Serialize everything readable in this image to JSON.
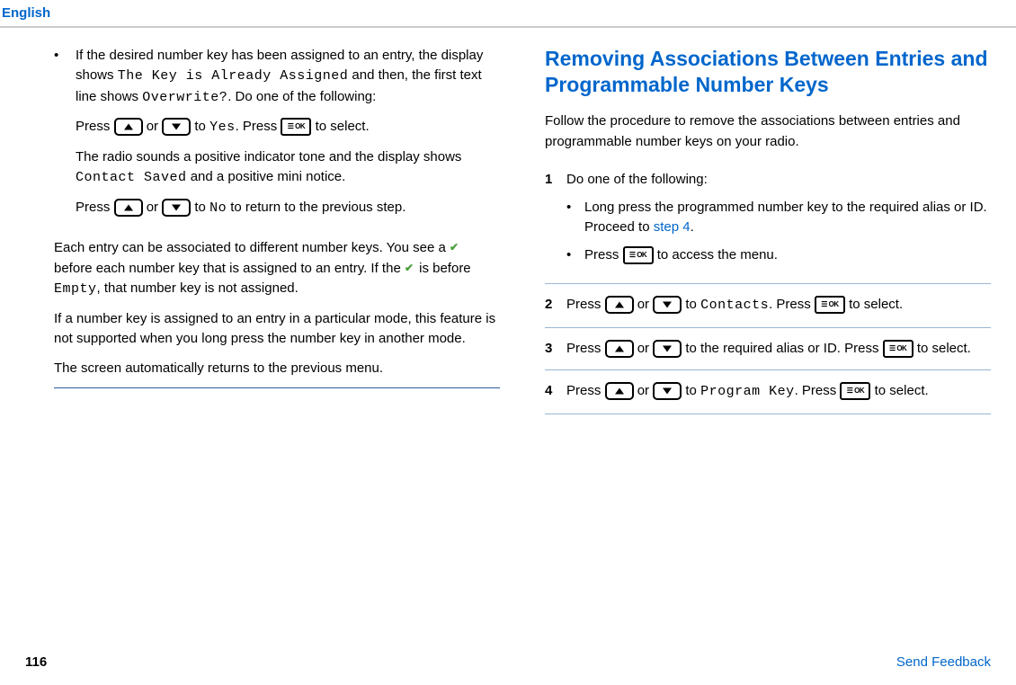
{
  "header": {
    "lang": "English"
  },
  "left": {
    "bullet1_a": "If the desired number key has been assigned to an entry, the display shows ",
    "bullet1_lcd1": "The Key is Already Assigned",
    "bullet1_b": " and then, the first text line shows ",
    "bullet1_lcd2": "Overwrite?",
    "bullet1_c": ". Do one of the following:",
    "press": "Press ",
    "or": " or ",
    "to": " to ",
    "yes": "Yes",
    "period_press": ". Press ",
    "to_select": " to select.",
    "para2_a": "The radio sounds a positive indicator tone and the display shows ",
    "para2_lcd": "Contact Saved",
    "para2_b": " and a positive mini notice.",
    "no": "No",
    "para3_b": " to return to the previous step.",
    "para4_a": "Each entry can be associated to different number keys. You see a ",
    "para4_b": " before each number key that is assigned to an entry. If the ",
    "para4_c": " is before ",
    "para4_lcd": "Empty",
    "para4_d": ", that number key is not assigned.",
    "para5": "If a number key is assigned to an entry in a particular mode, this feature is not supported when you long press the number key in another mode.",
    "para6": "The screen automatically returns to the previous menu."
  },
  "right": {
    "title": "Removing Associations Between Entries and Programmable Number Keys",
    "intro": "Follow the procedure to remove the associations between entries and programmable number keys on your radio.",
    "step1_text": "Do one of the following:",
    "step1_b1_a": "Long press the programmed number key to the required alias or ID. Proceed to ",
    "step1_b1_link": "step 4",
    "step1_b1_b": ".",
    "step1_b2_a": "Press ",
    "step1_b2_b": " to access the menu.",
    "step2_a": "Press ",
    "step2_or": " or ",
    "step2_to": " to ",
    "step2_lcd": "Contacts",
    "step2_b": ". Press ",
    "step2_c": " to select.",
    "step3_a": "Press ",
    "step3_or": " or ",
    "step3_b": " to the required alias or ID. Press ",
    "step3_c": " to select.",
    "step4_a": "Press ",
    "step4_or": " or ",
    "step4_to": " to ",
    "step4_lcd": "Program Key",
    "step4_b": ". Press ",
    "step4_c": " to select."
  },
  "footer": {
    "page": "116",
    "feedback": "Send Feedback"
  },
  "steps": {
    "n1": "1",
    "n2": "2",
    "n3": "3",
    "n4": "4"
  }
}
